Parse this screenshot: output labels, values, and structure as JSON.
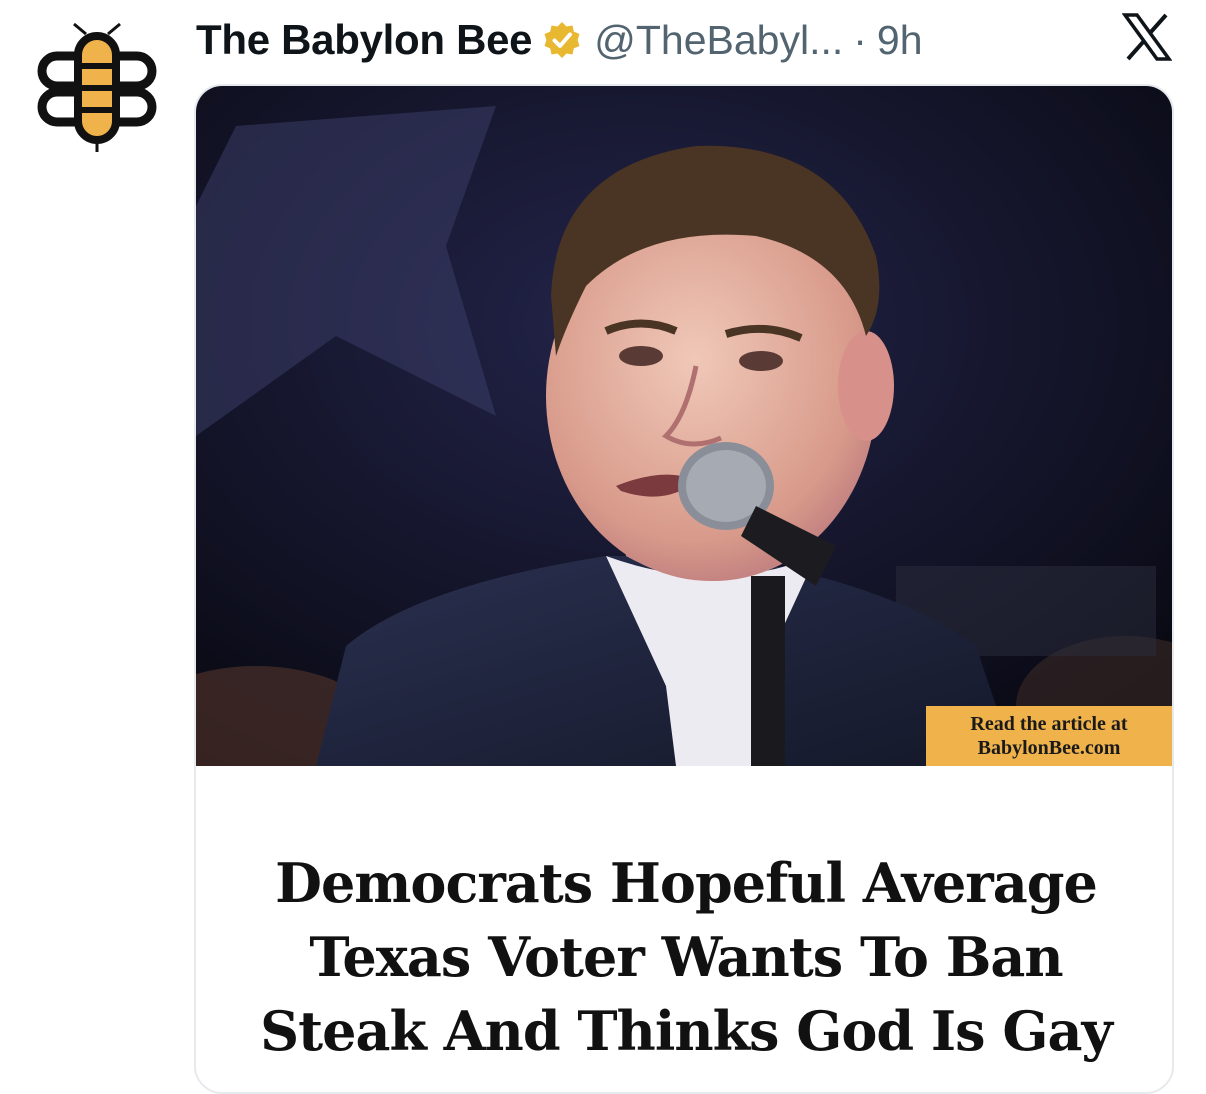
{
  "post": {
    "author_name": "The Babylon Bee",
    "handle": "@TheBabyl...",
    "separator": "·",
    "time": "9h"
  },
  "article": {
    "cta_line1": "Read the article at",
    "cta_line2": "BabylonBee.com",
    "headline_lines": [
      "Democrats Hopeful Average",
      "Texas Voter Wants To Ban",
      "Steak And Thinks God Is Gay"
    ]
  },
  "icons": {
    "avatar": "bee-logo-icon",
    "verified": "verified-badge-icon",
    "platform": "x-logo-icon"
  },
  "colors": {
    "accent_gold": "#f0b24b",
    "verified_gold": "#e8b831",
    "text_primary": "#0f1419",
    "text_secondary": "#536471"
  }
}
